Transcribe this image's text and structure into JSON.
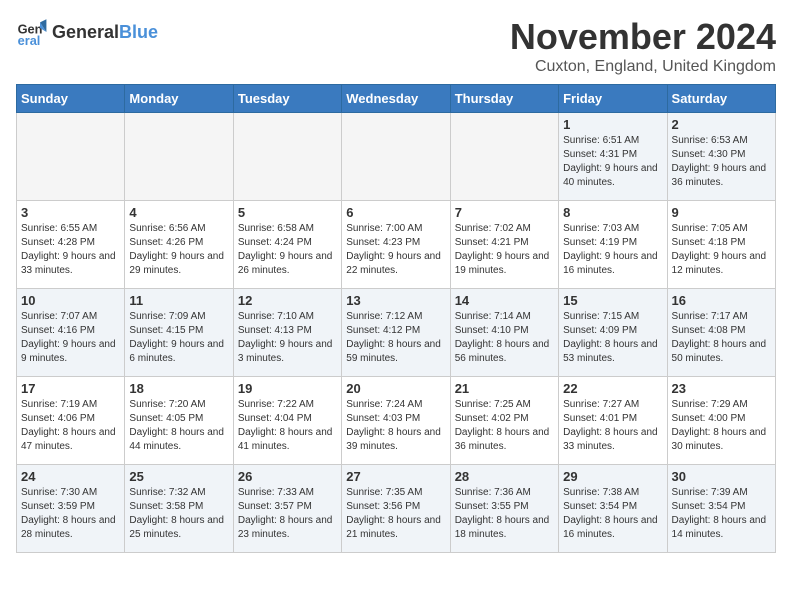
{
  "header": {
    "logo_general": "General",
    "logo_blue": "Blue",
    "month_title": "November 2024",
    "location": "Cuxton, England, United Kingdom"
  },
  "days_of_week": [
    "Sunday",
    "Monday",
    "Tuesday",
    "Wednesday",
    "Thursday",
    "Friday",
    "Saturday"
  ],
  "weeks": [
    [
      {
        "day": "",
        "info": "",
        "empty": true
      },
      {
        "day": "",
        "info": "",
        "empty": true
      },
      {
        "day": "",
        "info": "",
        "empty": true
      },
      {
        "day": "",
        "info": "",
        "empty": true
      },
      {
        "day": "",
        "info": "",
        "empty": true
      },
      {
        "day": "1",
        "info": "Sunrise: 6:51 AM\nSunset: 4:31 PM\nDaylight: 9 hours\nand 40 minutes.",
        "empty": false
      },
      {
        "day": "2",
        "info": "Sunrise: 6:53 AM\nSunset: 4:30 PM\nDaylight: 9 hours\nand 36 minutes.",
        "empty": false
      }
    ],
    [
      {
        "day": "3",
        "info": "Sunrise: 6:55 AM\nSunset: 4:28 PM\nDaylight: 9 hours\nand 33 minutes.",
        "empty": false
      },
      {
        "day": "4",
        "info": "Sunrise: 6:56 AM\nSunset: 4:26 PM\nDaylight: 9 hours\nand 29 minutes.",
        "empty": false
      },
      {
        "day": "5",
        "info": "Sunrise: 6:58 AM\nSunset: 4:24 PM\nDaylight: 9 hours\nand 26 minutes.",
        "empty": false
      },
      {
        "day": "6",
        "info": "Sunrise: 7:00 AM\nSunset: 4:23 PM\nDaylight: 9 hours\nand 22 minutes.",
        "empty": false
      },
      {
        "day": "7",
        "info": "Sunrise: 7:02 AM\nSunset: 4:21 PM\nDaylight: 9 hours\nand 19 minutes.",
        "empty": false
      },
      {
        "day": "8",
        "info": "Sunrise: 7:03 AM\nSunset: 4:19 PM\nDaylight: 9 hours\nand 16 minutes.",
        "empty": false
      },
      {
        "day": "9",
        "info": "Sunrise: 7:05 AM\nSunset: 4:18 PM\nDaylight: 9 hours\nand 12 minutes.",
        "empty": false
      }
    ],
    [
      {
        "day": "10",
        "info": "Sunrise: 7:07 AM\nSunset: 4:16 PM\nDaylight: 9 hours\nand 9 minutes.",
        "empty": false
      },
      {
        "day": "11",
        "info": "Sunrise: 7:09 AM\nSunset: 4:15 PM\nDaylight: 9 hours\nand 6 minutes.",
        "empty": false
      },
      {
        "day": "12",
        "info": "Sunrise: 7:10 AM\nSunset: 4:13 PM\nDaylight: 9 hours\nand 3 minutes.",
        "empty": false
      },
      {
        "day": "13",
        "info": "Sunrise: 7:12 AM\nSunset: 4:12 PM\nDaylight: 8 hours\nand 59 minutes.",
        "empty": false
      },
      {
        "day": "14",
        "info": "Sunrise: 7:14 AM\nSunset: 4:10 PM\nDaylight: 8 hours\nand 56 minutes.",
        "empty": false
      },
      {
        "day": "15",
        "info": "Sunrise: 7:15 AM\nSunset: 4:09 PM\nDaylight: 8 hours\nand 53 minutes.",
        "empty": false
      },
      {
        "day": "16",
        "info": "Sunrise: 7:17 AM\nSunset: 4:08 PM\nDaylight: 8 hours\nand 50 minutes.",
        "empty": false
      }
    ],
    [
      {
        "day": "17",
        "info": "Sunrise: 7:19 AM\nSunset: 4:06 PM\nDaylight: 8 hours\nand 47 minutes.",
        "empty": false
      },
      {
        "day": "18",
        "info": "Sunrise: 7:20 AM\nSunset: 4:05 PM\nDaylight: 8 hours\nand 44 minutes.",
        "empty": false
      },
      {
        "day": "19",
        "info": "Sunrise: 7:22 AM\nSunset: 4:04 PM\nDaylight: 8 hours\nand 41 minutes.",
        "empty": false
      },
      {
        "day": "20",
        "info": "Sunrise: 7:24 AM\nSunset: 4:03 PM\nDaylight: 8 hours\nand 39 minutes.",
        "empty": false
      },
      {
        "day": "21",
        "info": "Sunrise: 7:25 AM\nSunset: 4:02 PM\nDaylight: 8 hours\nand 36 minutes.",
        "empty": false
      },
      {
        "day": "22",
        "info": "Sunrise: 7:27 AM\nSunset: 4:01 PM\nDaylight: 8 hours\nand 33 minutes.",
        "empty": false
      },
      {
        "day": "23",
        "info": "Sunrise: 7:29 AM\nSunset: 4:00 PM\nDaylight: 8 hours\nand 30 minutes.",
        "empty": false
      }
    ],
    [
      {
        "day": "24",
        "info": "Sunrise: 7:30 AM\nSunset: 3:59 PM\nDaylight: 8 hours\nand 28 minutes.",
        "empty": false
      },
      {
        "day": "25",
        "info": "Sunrise: 7:32 AM\nSunset: 3:58 PM\nDaylight: 8 hours\nand 25 minutes.",
        "empty": false
      },
      {
        "day": "26",
        "info": "Sunrise: 7:33 AM\nSunset: 3:57 PM\nDaylight: 8 hours\nand 23 minutes.",
        "empty": false
      },
      {
        "day": "27",
        "info": "Sunrise: 7:35 AM\nSunset: 3:56 PM\nDaylight: 8 hours\nand 21 minutes.",
        "empty": false
      },
      {
        "day": "28",
        "info": "Sunrise: 7:36 AM\nSunset: 3:55 PM\nDaylight: 8 hours\nand 18 minutes.",
        "empty": false
      },
      {
        "day": "29",
        "info": "Sunrise: 7:38 AM\nSunset: 3:54 PM\nDaylight: 8 hours\nand 16 minutes.",
        "empty": false
      },
      {
        "day": "30",
        "info": "Sunrise: 7:39 AM\nSunset: 3:54 PM\nDaylight: 8 hours\nand 14 minutes.",
        "empty": false
      }
    ]
  ]
}
